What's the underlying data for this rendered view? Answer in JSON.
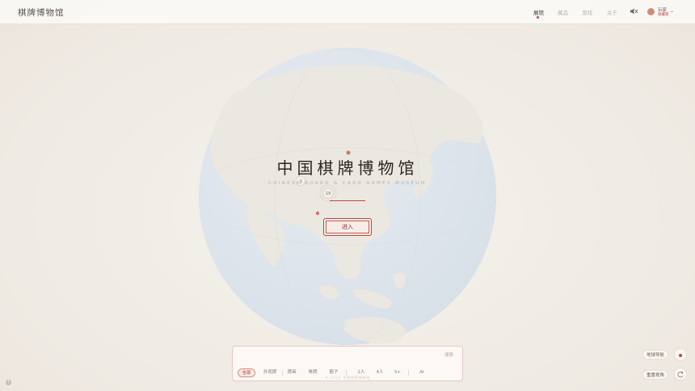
{
  "header": {
    "logo": "棋牌博物馆",
    "nav": [
      {
        "label": "展馆",
        "active": true
      },
      {
        "label": "藏品",
        "active": false
      },
      {
        "label": "游戏",
        "active": false
      },
      {
        "label": "关于",
        "active": false
      }
    ],
    "sound_icon": "speaker-icon",
    "user": {
      "name": "玩家",
      "subtitle": "收藏家"
    }
  },
  "hero": {
    "title": "中国棋牌博物馆",
    "subtitle": "CHINESE BOARD & CARD GAMES MUSEUM",
    "enter_label": "进入"
  },
  "globe": {
    "colors": {
      "ocean": "#e0e6ec",
      "land": "#ebe7e1",
      "accent": "#c0473d"
    },
    "markers": [
      {
        "label": ""
      },
      {
        "label": "3"
      },
      {
        "label": "19"
      },
      {
        "label": ""
      }
    ]
  },
  "search": {
    "placeholder": "",
    "hint": "",
    "button_label": "搜索",
    "chips": [
      {
        "label": "全部",
        "active": true
      },
      {
        "label": "外观牌",
        "active": false
      },
      {
        "label": "牌具",
        "active": false
      },
      {
        "label": "骨牌",
        "active": false
      },
      {
        "label": "骰子",
        "active": false
      },
      {
        "label": "2人",
        "active": false
      },
      {
        "label": "4人",
        "active": false
      },
      {
        "label": "5+",
        "active": false
      },
      {
        "label": "AI",
        "active": false
      }
    ],
    "copyright": "© 2024 中国棋牌博物馆"
  },
  "footer": {
    "text": ""
  },
  "side": {
    "guide_label": "地球导航",
    "reset_label": "重置视角"
  }
}
